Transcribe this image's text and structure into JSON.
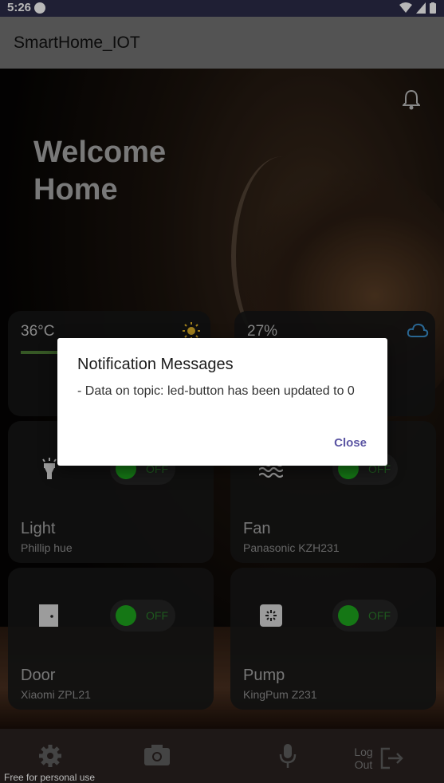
{
  "status_bar": {
    "time": "5:26"
  },
  "app_bar": {
    "title": "SmartHome_IOT"
  },
  "welcome": {
    "line1": "Welcome",
    "line2": "Home"
  },
  "stats": {
    "temperature": {
      "value": "36°C"
    },
    "humidity": {
      "value": "27%"
    }
  },
  "devices": [
    {
      "name": "Light",
      "model": "Phillip hue",
      "state": "OFF",
      "icon": "flashlight-icon"
    },
    {
      "name": "Fan",
      "model": "Panasonic KZH231",
      "state": "OFF",
      "icon": "wave-icon"
    },
    {
      "name": "Door",
      "model": "Xiaomi ZPL21",
      "state": "OFF",
      "icon": "door-icon"
    },
    {
      "name": "Pump",
      "model": "KingPum Z231",
      "state": "OFF",
      "icon": "pump-icon"
    }
  ],
  "bottom_nav": {
    "logout_label": "Log Out",
    "watermark": "Free for personal use"
  },
  "dialog": {
    "title": "Notification Messages",
    "message": "- Data on topic: led-button has been updated to 0",
    "close_label": "Close"
  },
  "colors": {
    "accent": "#5b55a3",
    "toggle_on": "#1ea51e",
    "status_bar": "#2c2c48",
    "app_bar": "#737373"
  }
}
